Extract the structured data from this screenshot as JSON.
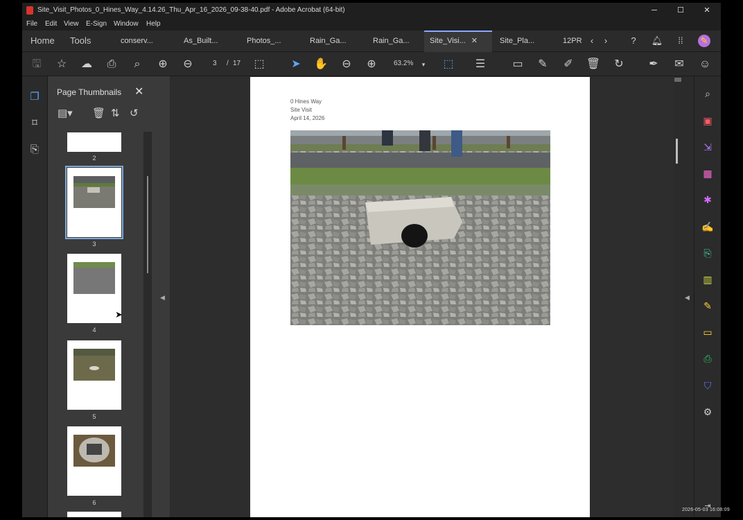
{
  "window": {
    "title": "Site_Visit_Photos_0_Hines_Way_4.14.26_Thu_Apr_16_2026_09-38-40.pdf - Adobe Acrobat (64-bit)",
    "controls": {
      "minimize": "─",
      "maximize": "☐",
      "close": "✕"
    }
  },
  "menu": [
    "File",
    "Edit",
    "View",
    "E-Sign",
    "Window",
    "Help"
  ],
  "tabs": {
    "home": "Home",
    "tools": "Tools",
    "docs": [
      "conserv...",
      "As_Built...",
      "Photos_...",
      "Rain_Ga...",
      "Rain_Ga..."
    ],
    "active": "Site_Visi...",
    "active_close": "✕",
    "after": [
      "Site_Pla...",
      "12PR"
    ]
  },
  "toolbar": {
    "page_current": "3",
    "page_separator": "/",
    "page_total": "17",
    "zoom": "63.2%"
  },
  "panel": {
    "title": "Page Thumbnails",
    "close": "✕",
    "thumbnails": [
      {
        "label": "2"
      },
      {
        "label": "3"
      },
      {
        "label": "4"
      },
      {
        "label": "5"
      },
      {
        "label": "6"
      }
    ]
  },
  "document": {
    "line1": "0 Hines Way",
    "line2": "Site Visit",
    "line3": "April 14, 2026"
  },
  "icons": {
    "left_rail": [
      "pages-icon",
      "bookmark-icon",
      "attachment-icon"
    ],
    "right_rail": [
      "zoom-icon",
      "create-pdf-icon",
      "export-pdf-icon",
      "organize-pages-icon",
      "edit-pdf-icon",
      "fill-sign-icon",
      "combine-files-icon",
      "compress-icon",
      "request-signature-icon",
      "comment-icon",
      "print-production-icon",
      "protect-icon",
      "more-tools-icon"
    ]
  },
  "overlay": {
    "timestamp": "2026-05-03 16:08:09"
  }
}
